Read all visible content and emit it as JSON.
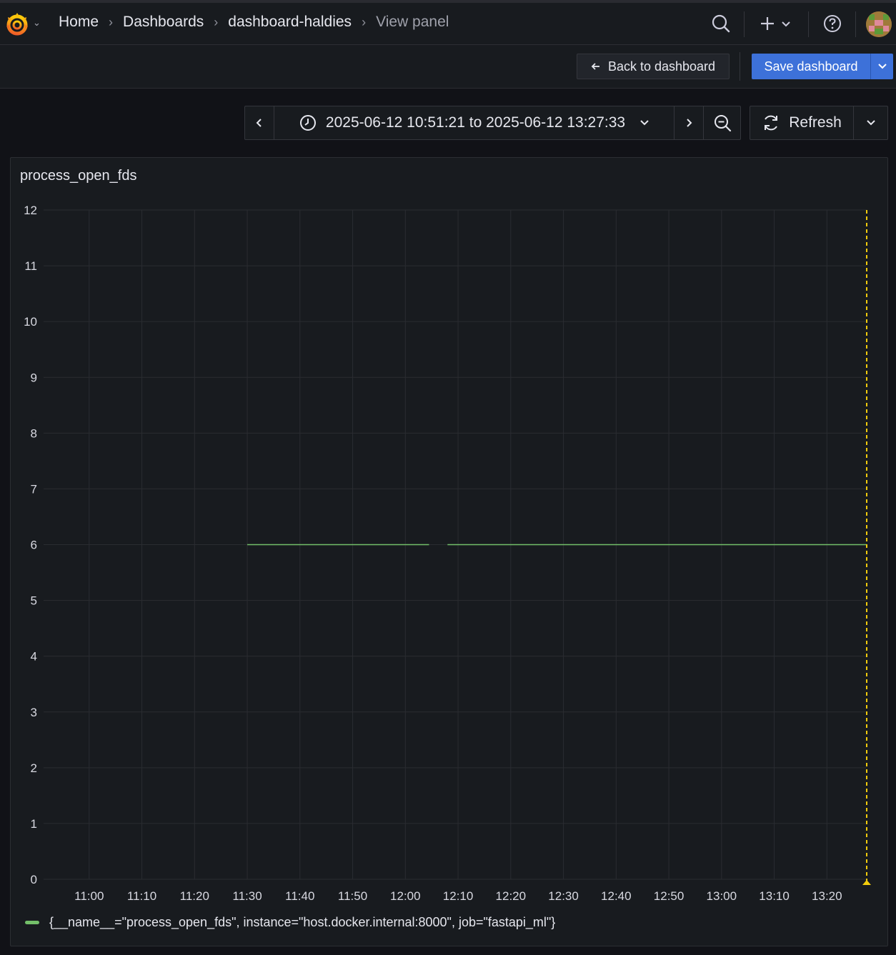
{
  "breadcrumbs": [
    {
      "label": "Home"
    },
    {
      "label": "Dashboards"
    },
    {
      "label": "dashboard-haldies"
    },
    {
      "label": "View panel"
    }
  ],
  "toolbar": {
    "back_label": "Back to dashboard",
    "save_label": "Save dashboard"
  },
  "time_picker": {
    "range_label": "2025-06-12 10:51:21 to 2025-06-12 13:27:33",
    "refresh_label": "Refresh"
  },
  "icons": {
    "logo": "grafana-logo-icon",
    "search": "search-icon",
    "add": "plus-icon",
    "help": "help-icon",
    "clock": "clock-icon",
    "zoom_out": "zoom-out-icon",
    "refresh": "refresh-icon"
  },
  "colors": {
    "series": "#73bf69",
    "now_marker": "#f2cc0c",
    "primary": "#3d71d9"
  },
  "panel": {
    "title": "process_open_fds"
  },
  "chart_data": {
    "type": "line",
    "title": "process_open_fds",
    "x_range": [
      "2025-06-12 10:51:21",
      "2025-06-12 13:27:33"
    ],
    "x_ticks": [
      "11:00",
      "11:10",
      "11:20",
      "11:30",
      "11:40",
      "11:50",
      "12:00",
      "12:10",
      "12:20",
      "12:30",
      "12:40",
      "12:50",
      "13:00",
      "13:10",
      "13:20"
    ],
    "y_ticks": [
      0,
      1,
      2,
      3,
      4,
      5,
      6,
      7,
      8,
      9,
      10,
      11,
      12
    ],
    "ylim": [
      0,
      12
    ],
    "grid": true,
    "legend_position": "bottom-left",
    "series": [
      {
        "name": "{__name__=\"process_open_fds\", instance=\"host.docker.internal:8000\", job=\"fastapi_ml\"}",
        "segments": [
          [
            [
              "2025-06-12 11:30:00",
              6
            ],
            [
              "2025-06-12 12:04:30",
              6
            ]
          ],
          [
            [
              "2025-06-12 12:08:00",
              6
            ],
            [
              "2025-06-12 13:27:33",
              6
            ]
          ]
        ]
      }
    ],
    "now_marker": "2025-06-12 13:27:33"
  }
}
